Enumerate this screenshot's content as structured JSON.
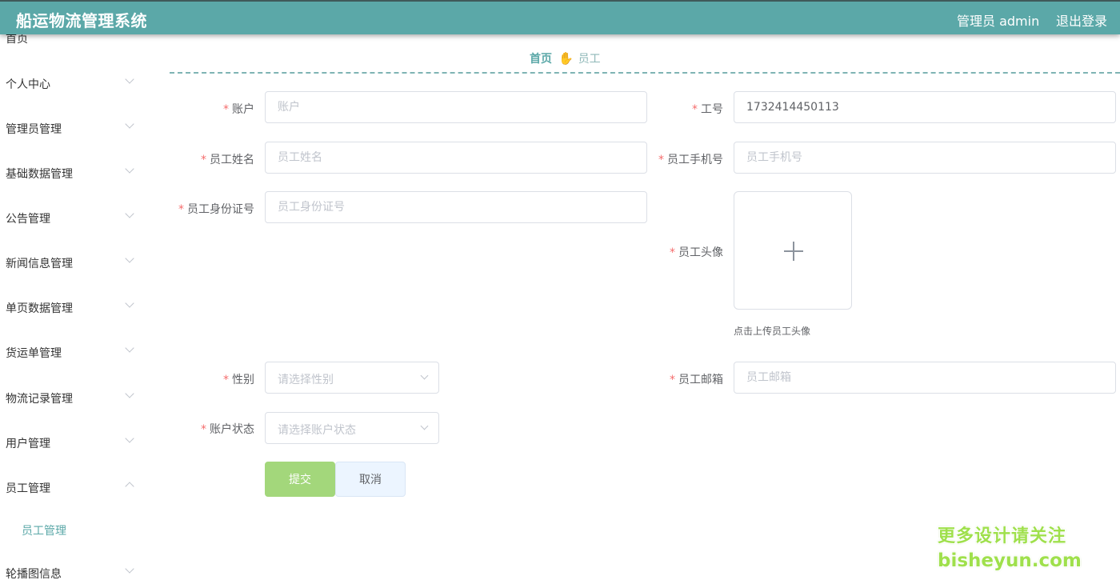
{
  "header": {
    "title": "船运物流管理系统",
    "user": "管理员 admin",
    "logout": "退出登录",
    "color": "#5ba8a8"
  },
  "sidebar": {
    "partial_top": "首页",
    "items": [
      {
        "label": "个人中心"
      },
      {
        "label": "管理员管理"
      },
      {
        "label": "基础数据管理"
      },
      {
        "label": "公告管理"
      },
      {
        "label": "新闻信息管理"
      },
      {
        "label": "单页数据管理"
      },
      {
        "label": "货运单管理"
      },
      {
        "label": "物流记录管理"
      },
      {
        "label": "用户管理"
      },
      {
        "label": "员工管理"
      },
      {
        "label": "轮播图信息"
      }
    ],
    "active_sub": "员工管理"
  },
  "breadcrumb": {
    "home": "首页",
    "current": "员工"
  },
  "form": {
    "account": {
      "label": "账户",
      "placeholder": "账户",
      "value": ""
    },
    "job_no": {
      "label": "工号",
      "value": "1732414450113"
    },
    "name": {
      "label": "员工姓名",
      "placeholder": "员工姓名"
    },
    "phone": {
      "label": "员工手机号",
      "placeholder": "员工手机号"
    },
    "id_card": {
      "label": "员工身份证号",
      "placeholder": "员工身份证号"
    },
    "avatar": {
      "label": "员工头像",
      "tip": "点击上传员工头像"
    },
    "gender": {
      "label": "性别",
      "placeholder": "请选择性别"
    },
    "email": {
      "label": "员工邮箱",
      "placeholder": "员工邮箱"
    },
    "status": {
      "label": "账户状态",
      "placeholder": "请选择账户状态"
    },
    "submit": "提交",
    "cancel": "取消"
  },
  "watermark": {
    "line1": "更多设计请关注",
    "line2": "bisheyun.com"
  }
}
